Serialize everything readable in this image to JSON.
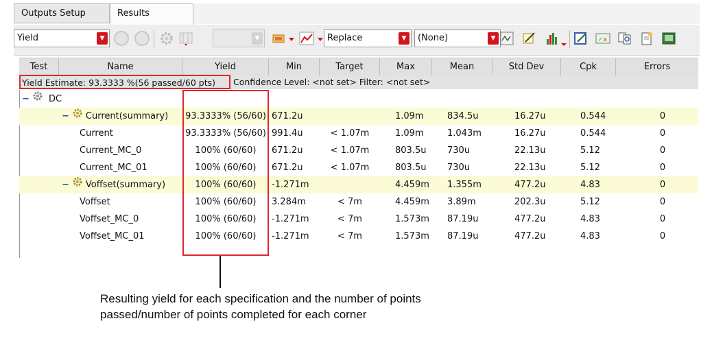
{
  "tabs": [
    "Outputs Setup",
    "Results"
  ],
  "toolbar": {
    "mode_value": "Yield",
    "replace_value": "Replace",
    "none_value": "(None)"
  },
  "columns": [
    "Test",
    "Name",
    "Yield",
    "Min",
    "Target",
    "Max",
    "Mean",
    "Std Dev",
    "Cpk",
    "Errors"
  ],
  "yield_estimate": "Yield Estimate: 93.3333 %(56 passed/60 pts)",
  "confidence": "Confidence Level: <not set>   Filter: <not set>",
  "tree_root": "DC",
  "rows": [
    {
      "name": "Current(summary)",
      "yield": "93.3333% (56/60)",
      "min": "671.2u",
      "target": "",
      "max": "1.09m",
      "mean": "834.5u",
      "std": "16.27u",
      "cpk": "0.544",
      "errors": "0"
    },
    {
      "name": "Current",
      "yield": "93.3333% (56/60)",
      "min": "991.4u",
      "target": "< 1.07m",
      "max": "1.09m",
      "mean": "1.043m",
      "std": "16.27u",
      "cpk": "0.544",
      "errors": "0"
    },
    {
      "name": "Current_MC_0",
      "yield": "100% (60/60)",
      "min": "671.2u",
      "target": "< 1.07m",
      "max": "803.5u",
      "mean": "730u",
      "std": "22.13u",
      "cpk": "5.12",
      "errors": "0"
    },
    {
      "name": "Current_MC_01",
      "yield": "100% (60/60)",
      "min": "671.2u",
      "target": "< 1.07m",
      "max": "803.5u",
      "mean": "730u",
      "std": "22.13u",
      "cpk": "5.12",
      "errors": "0"
    },
    {
      "name": "Voffset(summary)",
      "yield": "100% (60/60)",
      "min": "-1.271m",
      "target": "",
      "max": "4.459m",
      "mean": "1.355m",
      "std": "477.2u",
      "cpk": "4.83",
      "errors": "0"
    },
    {
      "name": "Voffset",
      "yield": "100% (60/60)",
      "min": "3.284m",
      "target": "< 7m",
      "max": "4.459m",
      "mean": "3.89m",
      "std": "202.3u",
      "cpk": "5.12",
      "errors": "0"
    },
    {
      "name": "Voffset_MC_0",
      "yield": "100% (60/60)",
      "min": "-1.271m",
      "target": "< 7m",
      "max": "1.573m",
      "mean": "87.19u",
      "std": "477.2u",
      "cpk": "4.83",
      "errors": "0"
    },
    {
      "name": "Voffset_MC_01",
      "yield": "100% (60/60)",
      "min": "-1.271m",
      "target": "< 7m",
      "max": "1.573m",
      "mean": "87.19u",
      "std": "477.2u",
      "cpk": "4.83",
      "errors": "0"
    }
  ],
  "caption": {
    "line1": "Resulting yield for each specification and the number of points",
    "line2": "passed/number of points completed for each corner"
  },
  "colors": {
    "accent_red": "#e0262b",
    "summary_bg": "#fbfbd6"
  }
}
